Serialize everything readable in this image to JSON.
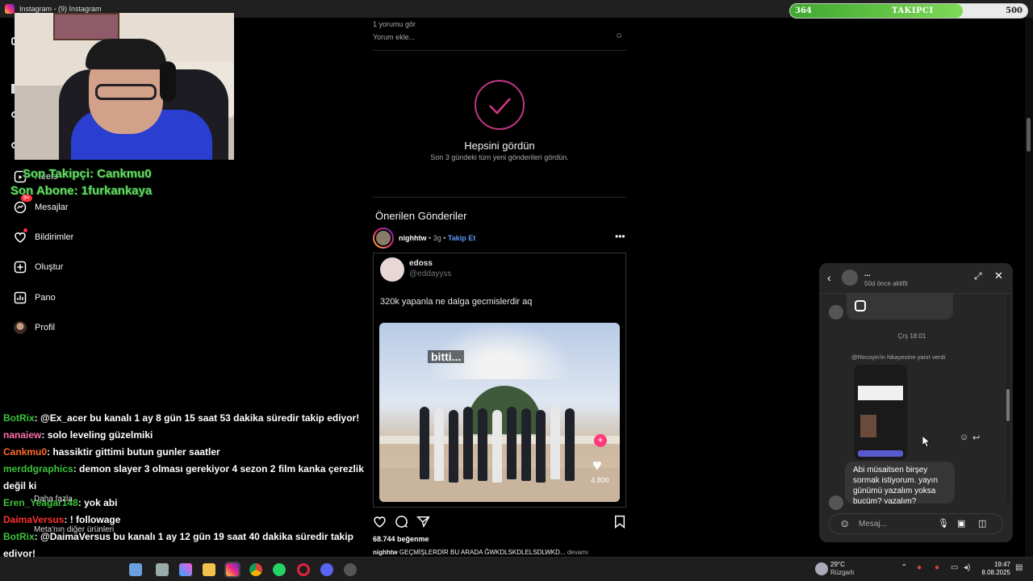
{
  "window": {
    "title": "Instagram - (9) Instagram"
  },
  "follow_goal": {
    "current": "364",
    "label": "TAKIPCI",
    "goal": "500",
    "progress_fraction": 0.728
  },
  "stream_overlay": {
    "last_follower": "Son Takipçi: Cankmu0",
    "last_sub": "Son Abone: 1furkankaya"
  },
  "sidebar": {
    "items": [
      {
        "label": "Reels",
        "icon": "reels-icon"
      },
      {
        "label": "Mesajlar",
        "icon": "messenger-icon",
        "badge": "9+"
      },
      {
        "label": "Bildirimler",
        "icon": "heart-icon"
      },
      {
        "label": "Oluştur",
        "icon": "plus-square-icon"
      },
      {
        "label": "Pano",
        "icon": "dashboard-icon"
      },
      {
        "label": "Profil",
        "icon": "avatar"
      }
    ],
    "more": "Daha fazla",
    "meta": "Meta'nın diğer ürünleri"
  },
  "chat": [
    {
      "user": "BotRix",
      "user_color": "#3cc43c",
      "msg": ": @Ex_acer bu kanalı 1 ay 8 gün 15 saat 53 dakika süredir takip ediyor!"
    },
    {
      "user": "nanaiew",
      "user_color": "#ff6fae",
      "msg": ": solo leveling güzelmiki"
    },
    {
      "user": "Cankmu0",
      "user_color": "#ff6a2a",
      "msg": ": hassiktir gittimi butun gunler saatler"
    },
    {
      "user": "merddgraphics",
      "user_color": "#3cc43c",
      "msg": ": demon slayer 3 olması gerekiyor 4 sezon 2 film kanka çerezlik değil ki"
    },
    {
      "user": "Eren_Yeagar148",
      "user_color": "#3cc43c",
      "msg": ": yok abi"
    },
    {
      "user": "DaimaVersus",
      "user_color": "#ff3030",
      "msg": ": ! followage"
    },
    {
      "user": "BotRix",
      "user_color": "#3cc43c",
      "msg": ": @DaimaVersus bu kanalı 1 ay 12 gün 19 saat 40 dakika süredir takip ediyor!"
    }
  ],
  "feed": {
    "prev_comments": "1 yorumu gör",
    "add_comment": "Yorum ekle...",
    "caught_up_title": "Hepsini gördün",
    "caught_up_sub": "Son 3 gündeki tüm yeni gönderileri gördün.",
    "suggested_title": "Önerilen Gönderiler",
    "post": {
      "user": "nighhtw",
      "time": "3g",
      "follow": "Takip Et",
      "tweet_name": "edoss",
      "tweet_handle": "@eddayyss",
      "tweet_text": "320k yapanla ne dalga gecmislerdir aq",
      "image_caption": "bitti...",
      "image_likes": "4.800",
      "likes": "68.744 beğenme",
      "caption_user": "nighhtw",
      "caption": "GEÇMİŞLERDİR BU ARADA ĞWKDLSKDLELSDLWKD...",
      "more": "devamı"
    }
  },
  "dm": {
    "name": "...",
    "status": "50d önce aktifti",
    "timestamp": "Çrş 18:01",
    "story_reply": "@Recoyin'in hikayesine yanıt verdi",
    "message": "Abi müsaitsen birşey sormak istiyorum. yayın günümü yazalım yoksa buçüm? yazalım?",
    "input_placeholder": "Mesaj..."
  },
  "taskbar": {
    "weather_temp": "29°C",
    "weather_desc": "Rüzgarlı",
    "time": "19:47",
    "date": "8.08.2025"
  }
}
